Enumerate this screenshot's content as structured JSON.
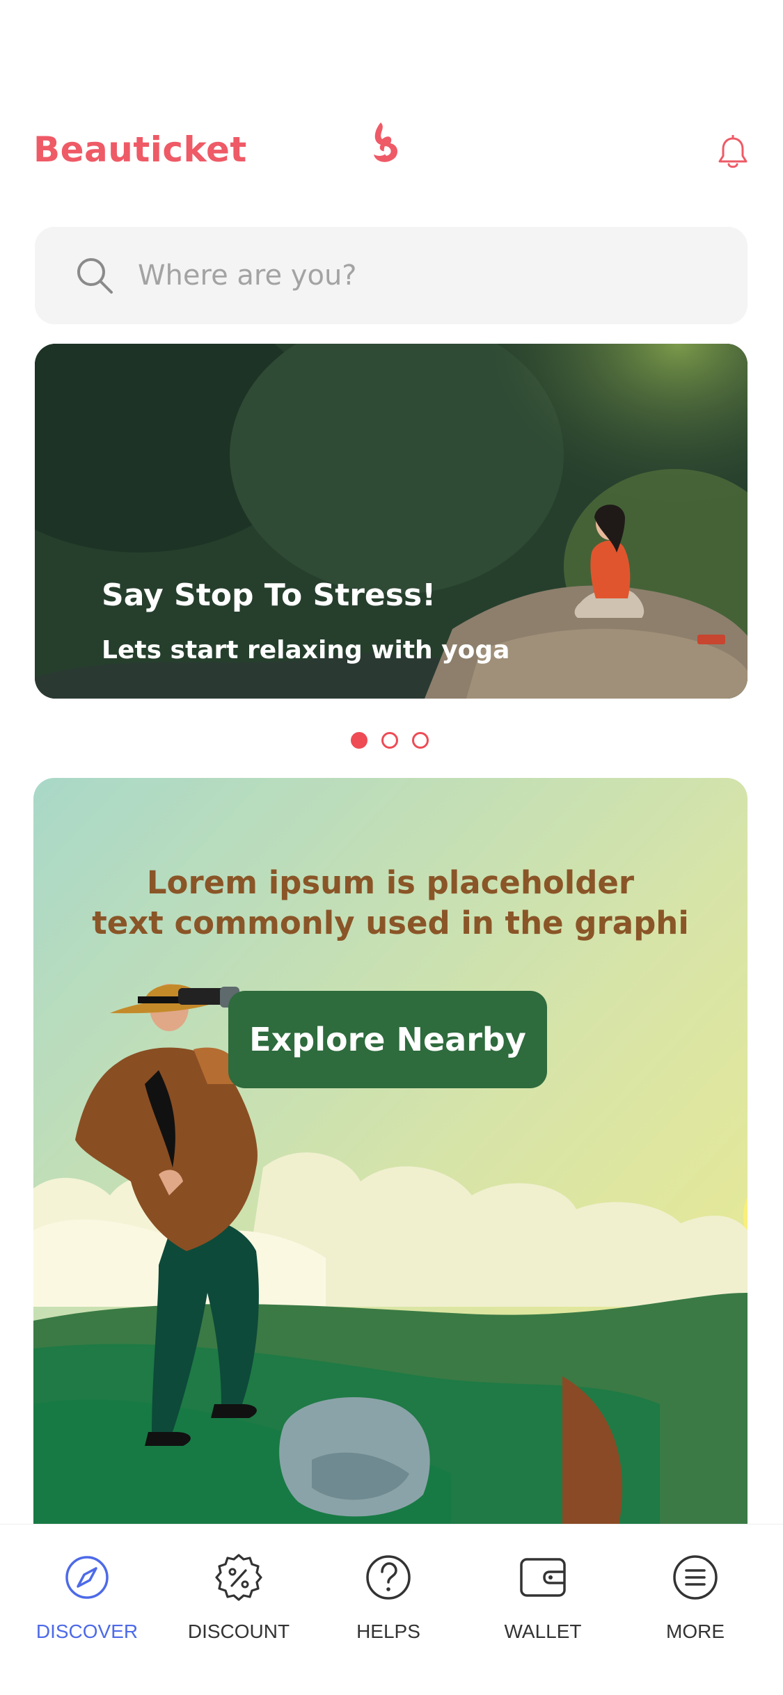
{
  "app": {
    "brand_name": "Beauticket"
  },
  "search": {
    "placeholder": "Where are you?"
  },
  "banner": {
    "title": "Say Stop To Stress!",
    "subtitle": "Lets start relaxing with yoga"
  },
  "carousel": {
    "count": 3,
    "active_index": 0
  },
  "promo": {
    "text_line1": "Lorem ipsum is placeholder",
    "text_line2": "text commonly used in the graphi",
    "button_label": "Explore Nearby"
  },
  "tabs": [
    {
      "label": "DISCOVER",
      "icon": "compass-icon",
      "active": true
    },
    {
      "label": "DISCOUNT",
      "icon": "percent-badge-icon",
      "active": false
    },
    {
      "label": "HELPS",
      "icon": "question-circle-icon",
      "active": false
    },
    {
      "label": "WALLET",
      "icon": "wallet-icon",
      "active": false
    },
    {
      "label": "MORE",
      "icon": "menu-circle-icon",
      "active": false
    }
  ],
  "colors": {
    "brand": "#ee5a66",
    "active_tab": "#4d6ae8",
    "button": "#2e6b3d",
    "promo_text": "#8a5527"
  }
}
